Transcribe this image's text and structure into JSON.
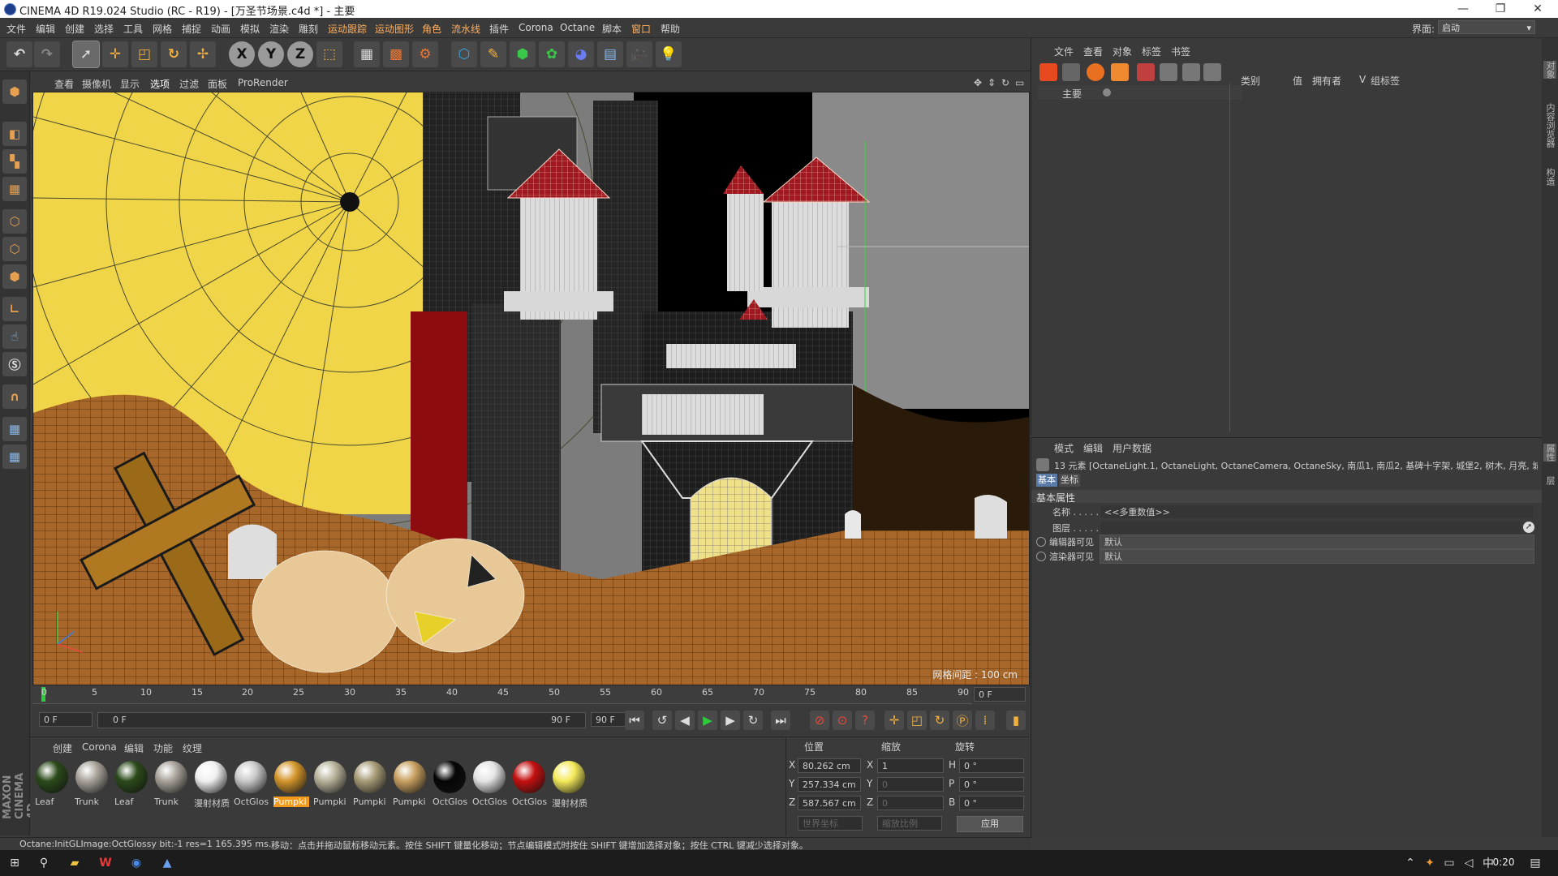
{
  "window": {
    "title": "CINEMA 4D R19.024 Studio (RC - R19) - [万圣节场景.c4d *] - 主要",
    "controls": [
      "—",
      "❐",
      "✕"
    ]
  },
  "menubar": {
    "items": [
      "文件",
      "编辑",
      "创建",
      "选择",
      "工具",
      "网格",
      "捕捉",
      "动画",
      "模拟",
      "渲染",
      "雕刻",
      "运动跟踪",
      "运动图形",
      "角色",
      "流水线",
      "插件",
      "Corona",
      "Octane",
      "脚本",
      "窗口",
      "帮助"
    ],
    "layout_label": "界面:",
    "layout_value": "启动"
  },
  "toolbar": {
    "axis_labels": [
      "X",
      "Y",
      "Z"
    ]
  },
  "viewport": {
    "menu": [
      "查看",
      "摄像机",
      "显示",
      "选项",
      "过滤",
      "面板",
      "ProRender"
    ],
    "grid_label": "网格间距 : 100 cm"
  },
  "timeline": {
    "ticks": [
      "0",
      "5",
      "10",
      "15",
      "20",
      "25",
      "30",
      "35",
      "40",
      "45",
      "50",
      "55",
      "60",
      "65",
      "70",
      "75",
      "80",
      "85",
      "90"
    ],
    "current_frame_display": "0 F",
    "playhead_frame": 0,
    "frame_start": "0 F",
    "range_start": "0 F",
    "range_end": "90 F",
    "frame_end": "90 F"
  },
  "material_manager": {
    "menu": [
      "创建",
      "Corona",
      "编辑",
      "功能",
      "纹理"
    ],
    "materials": [
      {
        "label": "Leaf",
        "color": "#2b4a1a"
      },
      {
        "label": "Trunk",
        "color": "#a8a29a"
      },
      {
        "label": "Leaf",
        "color": "#2b4a1a"
      },
      {
        "label": "Trunk",
        "color": "#a8a29a"
      },
      {
        "label": "漫射材质",
        "color": "#f0f0f0"
      },
      {
        "label": "OctGlos",
        "color": "#c9c9c9"
      },
      {
        "label": "Pumpki",
        "color": "#d4962c",
        "selected": true
      },
      {
        "label": "Pumpki",
        "color": "#b8b29a"
      },
      {
        "label": "Pumpki",
        "color": "#a89c78"
      },
      {
        "label": "Pumpki",
        "color": "#c8a060"
      },
      {
        "label": "OctGlos",
        "color": "#060606"
      },
      {
        "label": "OctGlos",
        "color": "#e4e4e4"
      },
      {
        "label": "OctGlos",
        "color": "#c41010"
      },
      {
        "label": "漫射材质",
        "color": "#f4ea5a"
      }
    ]
  },
  "coordinates": {
    "headers": [
      "位置",
      "缩放",
      "旋转"
    ],
    "rows": [
      {
        "axis": "X",
        "pos": "80.262 cm",
        "scale_axis": "X",
        "scale": "1",
        "rot_axis": "H",
        "rot": "0 °"
      },
      {
        "axis": "Y",
        "pos": "257.334 cm",
        "scale_axis": "Y",
        "scale": "0",
        "rot_axis": "P",
        "rot": "0 °"
      },
      {
        "axis": "Z",
        "pos": "587.567 cm",
        "scale_axis": "Z",
        "scale": "0",
        "rot_axis": "B",
        "rot": "0 °"
      }
    ],
    "mode_world": "世界坐标",
    "mode_scale": "缩放比例",
    "apply": "应用"
  },
  "status": {
    "left": "Octane:InitGLImage:OctGlossy  bit:-1 res=1  165.395 ms.",
    "right": "移动：点击并拖动鼠标移动元素。按住 SHIFT 键量化移动；节点编辑模式时按住 SHIFT 键增加选择对象；按住 CTRL 键减少选择对象。"
  },
  "object_manager": {
    "menu": [
      "文件",
      "查看",
      "对象",
      "标签",
      "书签"
    ],
    "root_item": "主要",
    "columns": [
      "类别",
      "值",
      "拥有者",
      "V",
      "组标签"
    ]
  },
  "attribute_manager": {
    "menu": [
      "模式",
      "编辑",
      "用户数据"
    ],
    "selection_summary": "13 元素 [OctaneLight.1, OctaneLight, OctaneCamera, OctaneSky, 南瓜1, 南瓜2, 基碑十字架, 城堡2, 树木, 月亮, 城堡, 山",
    "tabs": [
      "基本",
      "坐标"
    ],
    "section": "基本属性",
    "fields": [
      {
        "label": "名称 . . . . .",
        "value": "<<多重数值>>"
      },
      {
        "label": "图层 . . . . .",
        "value": ""
      },
      {
        "label": "编辑器可见",
        "value": "默认"
      },
      {
        "label": "渲染器可见",
        "value": "默认"
      }
    ]
  },
  "right_tabs": [
    "对象",
    "内容浏览器",
    "构造",
    "属性",
    "层"
  ],
  "taskbar": {
    "time": "0:20",
    "apps": [
      "start-icon",
      "search-icon",
      "file-explorer-icon",
      "wps-icon",
      "chrome-icon",
      "cinema4d-icon"
    ]
  }
}
